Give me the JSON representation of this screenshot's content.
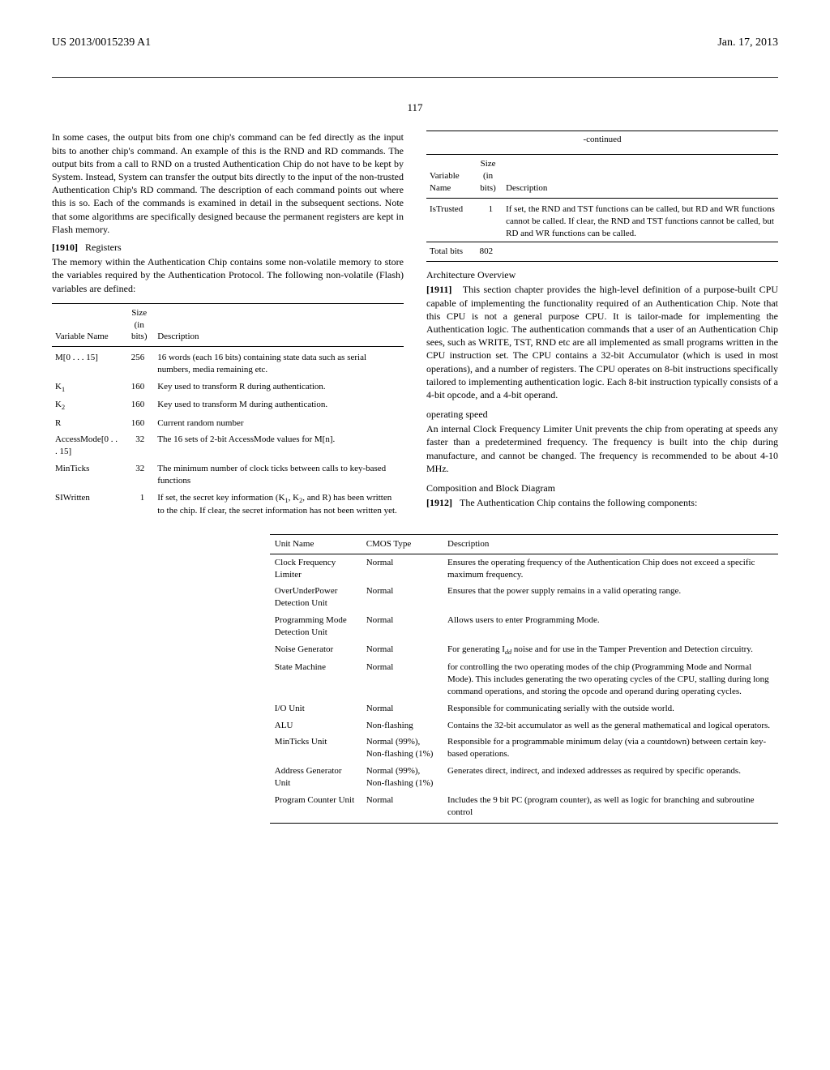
{
  "header": {
    "left": "US 2013/0015239 A1",
    "right": "Jan. 17, 2013",
    "page_number": "117"
  },
  "left_col": {
    "intro": "In some cases, the output bits from one chip's command can be fed directly as the input bits to another chip's command. An example of this is the RND and RD commands. The output bits from a call to RND on a trusted Authentication Chip do not have to be kept by System. Instead, System can transfer the output bits directly to the input of the non-trusted Authentication Chip's RD command. The description of each command points out where this is so. Each of the commands is examined in detail in the subsequent sections. Note that some algorithms are specifically designed because the permanent registers are kept in Flash memory.",
    "registers_label": "[1910]",
    "registers_title": "Registers",
    "registers_body": "The memory within the Authentication Chip contains some non-volatile memory to store the variables required by the Authentication Protocol. The following non-volatile (Flash) variables are defined:"
  },
  "vars_table": {
    "headers": {
      "name": "Variable Name",
      "size_top": "Size",
      "size_bottom": "(in bits)",
      "desc": "Description"
    },
    "rows": [
      {
        "name": "M[0 . . . 15]",
        "size": "256",
        "desc": "16 words (each 16 bits) containing state data such as serial numbers, media remaining etc."
      },
      {
        "name": "K₁",
        "size": "160",
        "desc": "Key used to transform R during authentication."
      },
      {
        "name": "K₂",
        "size": "160",
        "desc": "Key used to transform M during authentication."
      },
      {
        "name": "R",
        "size": "160",
        "desc": "Current random number"
      },
      {
        "name": "AccessMode[0 . . . 15]",
        "size": "32",
        "desc": "The 16 sets of 2-bit AccessMode values for M[n]."
      },
      {
        "name": "MinTicks",
        "size": "32",
        "desc": "The minimum number of clock ticks between calls to key-based functions"
      },
      {
        "name": "SIWritten",
        "size": "1",
        "desc": "If set, the secret key information (K₁, K₂, and R) has been written to the chip. If clear, the secret information has not been written yet."
      }
    ]
  },
  "vars_table_cont": {
    "continued": "-continued",
    "rows": [
      {
        "name": "IsTrusted",
        "size": "1",
        "desc": "If set, the RND and TST functions can be called, but RD and WR functions cannot be called. If clear, the RND and TST functions cannot be called, but RD and WR functions can be called."
      }
    ],
    "totals": {
      "name": "Total bits",
      "size": "802"
    }
  },
  "right_col": {
    "arch_head": "Architecture Overview",
    "arch_label": "[1911]",
    "arch_body": "This section chapter provides the high-level definition of a purpose-built CPU capable of implementing the functionality required of an Authentication Chip. Note that this CPU is not a general purpose CPU. It is tailor-made for implementing the Authentication logic. The authentication commands that a user of an Authentication Chip sees, such as WRITE, TST, RND etc are all implemented as small programs written in the CPU instruction set. The CPU contains a 32-bit Accumulator (which is used in most operations), and a number of registers. The CPU operates on 8-bit instructions specifically tailored to implementing authentication logic. Each 8-bit instruction typically consists of a 4-bit opcode, and a 4-bit operand.",
    "opspeed_head": "operating speed",
    "opspeed_body": "An internal Clock Frequency Limiter Unit prevents the chip from operating at speeds any faster than a predetermined frequency. The frequency is built into the chip during manufacture, and cannot be changed. The frequency is recommended to be about 4-10 MHz.",
    "comp_head": "Composition and Block Diagram",
    "comp_label": "[1912]",
    "comp_body": "The Authentication Chip contains the following components:"
  },
  "components_table": {
    "headers": {
      "unit": "Unit Name",
      "cmos": "CMOS Type",
      "desc": "Description"
    },
    "rows": [
      {
        "unit": "Clock Frequency Limiter",
        "cmos": "Normal",
        "desc": "Ensures the operating frequency of the Authentication Chip does not exceed a specific maximum frequency."
      },
      {
        "unit": "OverUnderPower Detection Unit",
        "cmos": "Normal",
        "desc": "Ensures that the power supply remains in a valid operating range."
      },
      {
        "unit": "Programming Mode Detection Unit",
        "cmos": "Normal",
        "desc": "Allows users to enter Programming Mode."
      },
      {
        "unit": "Noise Generator",
        "cmos": "Normal",
        "desc": "For generating Iₙₙ noise and for use in the Tamper Prevention and Detection circuitry."
      },
      {
        "unit": "State Machine",
        "cmos": "Normal",
        "desc": "for controlling the two operating modes of the chip (Programming Mode and Normal Mode). This includes generating the two operating cycles of the CPU, stalling during long command operations, and storing the opcode and operand during operating cycles."
      },
      {
        "unit": "I/O Unit",
        "cmos": "Normal",
        "desc": "Responsible for communicating serially with the outside world."
      },
      {
        "unit": "ALU",
        "cmos": "Non-flashing",
        "desc": "Contains the 32-bit accumulator as well as the general mathematical and logical operators."
      },
      {
        "unit": "MinTicks Unit",
        "cmos": "Normal (99%), Non-flashing (1%)",
        "desc": "Responsible for a programmable minimum delay (via a countdown) between certain key-based operations."
      },
      {
        "unit": "Address Generator Unit",
        "cmos": "Normal (99%), Non-flashing (1%)",
        "desc": "Generates direct, indirect, and indexed addresses as required by specific operands."
      },
      {
        "unit": "Program Counter Unit",
        "cmos": "Normal",
        "desc": "Includes the 9 bit PC (program counter), as well as logic for branching and subroutine control"
      }
    ]
  }
}
